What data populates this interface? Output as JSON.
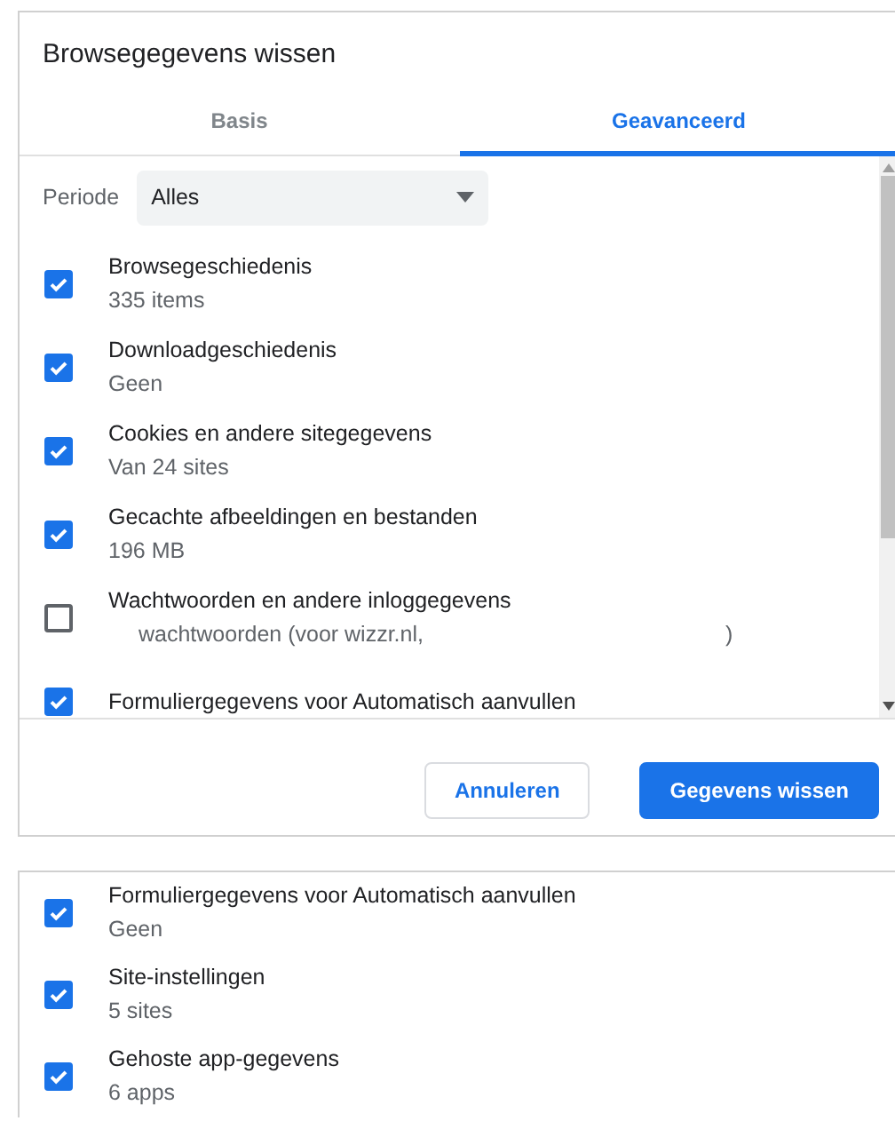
{
  "dialog": {
    "title": "Browsegegevens wissen",
    "tabs": [
      {
        "label": "Basis",
        "selected": false
      },
      {
        "label": "Geavanceerd",
        "selected": true
      }
    ],
    "period": {
      "label": "Periode",
      "value": "Alles"
    },
    "items": [
      {
        "label": "Browsegeschiedenis",
        "detail": "335 items",
        "checked": true
      },
      {
        "label": "Downloadgeschiedenis",
        "detail": "Geen",
        "checked": true
      },
      {
        "label": "Cookies en andere sitegegevens",
        "detail": "Van 24 sites",
        "checked": true
      },
      {
        "label": "Gecachte afbeeldingen en bestanden",
        "detail": "196 MB",
        "checked": true
      },
      {
        "label": "Wachtwoorden en andere inloggegevens",
        "detail": "wachtwoorden (voor wizzr.nl,",
        "detail_end": ")",
        "checked": false
      },
      {
        "label": "Formuliergegevens voor Automatisch aanvullen",
        "checked": true
      }
    ],
    "buttons": [
      {
        "label": "Annuleren",
        "kind": "secondary"
      },
      {
        "label": "Gegevens wissen",
        "kind": "primary"
      }
    ]
  },
  "scrolled_list": {
    "items": [
      {
        "label": "Formuliergegevens voor Automatisch aanvullen",
        "detail": "Geen",
        "checked": true
      },
      {
        "label": "Site-instellingen",
        "detail": "5 sites",
        "checked": true
      },
      {
        "label": "Gehoste app-gegevens",
        "detail": "6 apps",
        "checked": true
      }
    ]
  }
}
